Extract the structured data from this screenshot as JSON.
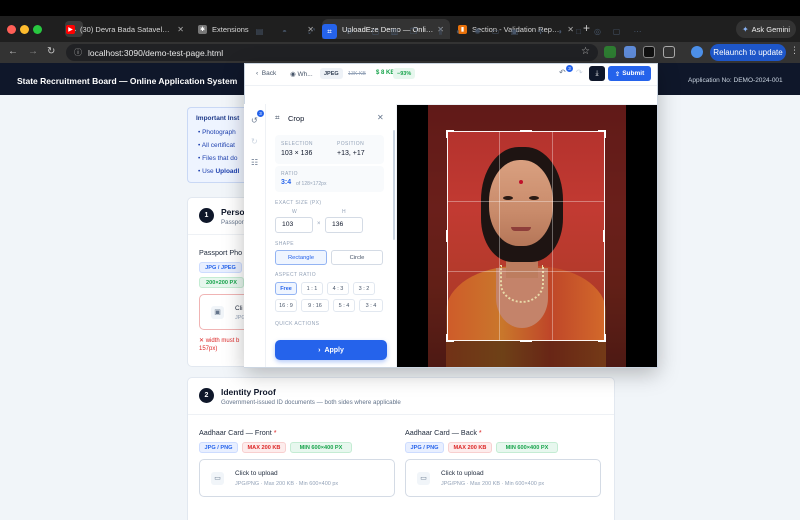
{
  "browser": {
    "tabs": [
      {
        "title": "(30) Devra Bada Satavela Al",
        "favicon": "youtube-icon",
        "active": false
      },
      {
        "title": "Extensions",
        "favicon": "puzzle-icon",
        "active": false
      },
      {
        "title": "UploadEze Demo — Online A",
        "favicon": "globe-icon",
        "active": true
      },
      {
        "title": "Section - Validation Report -",
        "favicon": "report-icon",
        "active": false
      }
    ],
    "ask_gemini": "Ask Gemini",
    "url": "localhost:3090/demo-test-page.html",
    "relaunch": "Relaunch to update"
  },
  "header": {
    "title": "State Recruitment Board — Online Application System",
    "app_no": "Application No: DEMO-2024-001"
  },
  "instructions": {
    "title": "Important Inst",
    "items": [
      "Photograph",
      "All certificat",
      "Files that do",
      "Use "
    ],
    "item4_bold": "Uploadl"
  },
  "section1": {
    "num": "1",
    "title": "Person",
    "sub": "Passpor",
    "field_label": "Passport Pho",
    "pill_format": "JPG / JPEG",
    "pill_size": "200×200 PX",
    "upload_title": "Cli",
    "upload_hint": "JPG",
    "err_line1": "✕ width must b",
    "err_line2": "157px)"
  },
  "section2": {
    "num": "2",
    "title": "Identity Proof",
    "sub": "Government-issued ID documents — both sides where applicable",
    "front": {
      "label": "Aadhaar Card — Front",
      "req": "*",
      "pills": [
        "JPG / PNG",
        "MAX 200 KB",
        "MIN 600×400 PX"
      ],
      "upload_title": "Click to upload",
      "upload_hint": "JPG/PNG · Max 200 KB · Min 600×400 px"
    },
    "back": {
      "label": "Aadhaar Card — Back",
      "req": "*",
      "pills": [
        "JPG / PNG",
        "MAX 200 KB",
        "MIN 600×400 PX"
      ],
      "upload_title": "Click to upload",
      "upload_hint": "JPG/PNG · Max 200 KB · Min 600×400 px"
    }
  },
  "editor": {
    "back": "Back",
    "file": "Wh...",
    "format": "JPEG",
    "size_old": "13K KB",
    "size_new": "8 KB",
    "reduction": "−93%",
    "undo_badge": "3",
    "rail_badge": "3",
    "submit": "Submit",
    "panel": {
      "title": "Crop",
      "selection_label": "SELECTION",
      "selection_value": "103 × 136",
      "position_label": "POSITION",
      "position_value": "+13, +17",
      "ratio_label": "RATIO",
      "ratio_value": "3:4",
      "ratio_sub": "of 128×172px",
      "exact_size_label": "EXACT SIZE (PX)",
      "w_label": "W",
      "h_label": "H",
      "width": "103",
      "height": "136",
      "times": "×",
      "shape_label": "SHAPE",
      "shape_rect": "Rectangle",
      "shape_circle": "Circle",
      "aspect_label": "ASPECT RATIO",
      "aspect": [
        "Free",
        "1 : 1",
        "4 : 3",
        "3 : 2",
        "16 : 9",
        "9 : 16",
        "5 : 4",
        "3 : 4"
      ],
      "quick_label": "QUICK ACTIONS",
      "apply": "Apply"
    }
  },
  "colors": {
    "accent": "#2563eb",
    "header_bg": "#0f172a",
    "error": "#dc2626",
    "success": "#16a34a"
  }
}
